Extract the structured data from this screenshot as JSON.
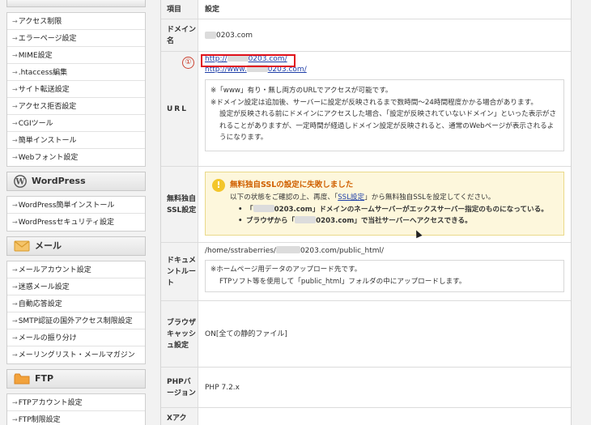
{
  "sidebar": {
    "group1": [
      "アクセス制限",
      "エラーページ設定",
      "MIME設定",
      ".htaccess編集",
      "サイト転送設定",
      "アクセス拒否設定",
      "CGIツール",
      "簡単インストール",
      "Webフォント設定"
    ],
    "wordpress": {
      "title": "WordPress",
      "items": [
        "WordPress簡単インストール",
        "WordPressセキュリティ設定"
      ]
    },
    "mail": {
      "title": "メール",
      "items": [
        "メールアカウント設定",
        "迷惑メール設定",
        "自動応答設定",
        "SMTP認証の国外アクセス制限設定",
        "メールの振り分け",
        "メーリングリスト・メールマガジン"
      ]
    },
    "ftp": {
      "title": "FTP",
      "items": [
        "FTPアカウント設定",
        "FTP制限設定"
      ]
    },
    "arrow": "→"
  },
  "table": {
    "col_item": "項目",
    "col_setting": "設定",
    "domain": {
      "label": "ドメイン名",
      "value": "0203.com"
    },
    "url": {
      "label": "URL",
      "marker": "①",
      "link1_prefix": "http://",
      "link1_suffix": "0203.com/",
      "link2_prefix": "http://www.",
      "link2_suffix": "0203.com/",
      "note1": "※「www」有り・無し両方のURLでアクセスが可能です。",
      "note2": "※ドメイン設定は追加後、サーバーに設定が反映されるまで数時間〜24時間程度かかる場合があります。",
      "note3": "設定が反映される前にドメインにアクセスした場合、「設定が反映されていないドメイン」といった表示がされることがありますが、一定時間が経過しドメイン設定が反映されると、通常のWebページが表示されるようになります。"
    },
    "ssl": {
      "label": "無料独自SSL設定",
      "warn_icon": "!",
      "title": "無料独自SSLの設定に失敗しました",
      "desc_before": "以下の状態をご確認の上、再度、「",
      "desc_link": "SSL設定",
      "desc_after": "」から無料独自SSLを設定してください。",
      "bullet1_a": "「",
      "bullet1_b": "0203.com」ドメインのネームサーバーがエックスサーバー指定のものになっている。",
      "bullet2_a": "ブラウザから「",
      "bullet2_b": "0203.com」で当社サーバーへアクセスできる。"
    },
    "docroot": {
      "label": "ドキュメントルート",
      "path_prefix": "/home/sstraberries/",
      "path_suffix": "0203.com/public_html/",
      "note1": "※ホームページ用データのアップロード先です。",
      "note2": "FTPソフト等を使用して「public_html」フォルダの中にアップロードします。"
    },
    "cache": {
      "label": "ブラウザキャッシュ設定",
      "value": "ON[全ての静的ファイル]"
    },
    "php": {
      "label": "PHPバージョン",
      "value": "PHP 7.2.x"
    },
    "x": {
      "label": "Xアク"
    }
  }
}
